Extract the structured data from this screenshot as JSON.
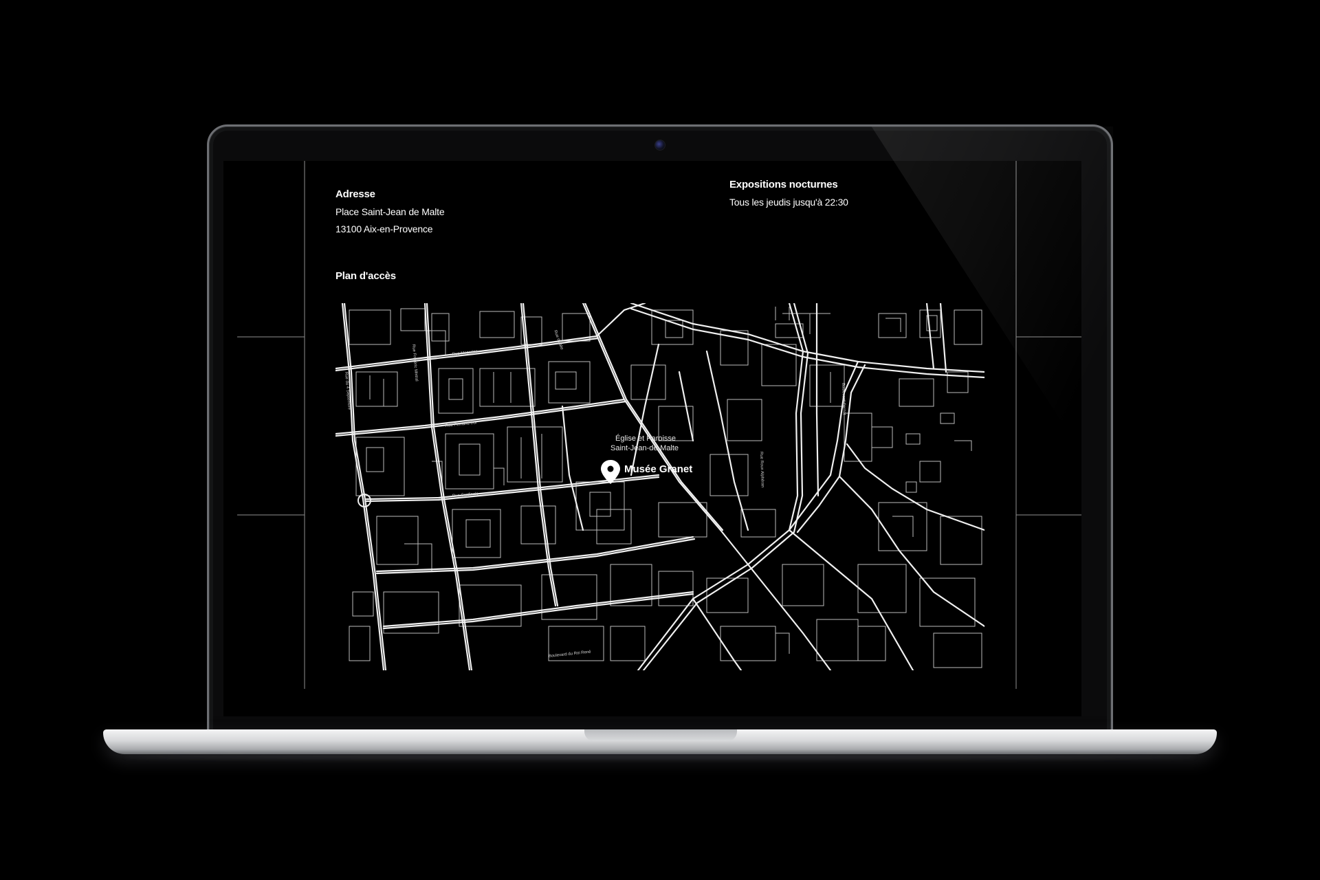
{
  "address": {
    "heading": "Adresse",
    "line1": "Place Saint-Jean de Malte",
    "line2": "13100 Aix-en-Provence"
  },
  "night_exhibitions": {
    "heading": "Expositions nocturnes",
    "text": "Tous les jeudis jusqu'à 22:30"
  },
  "access_map": {
    "heading": "Plan d'accès",
    "museum_label": "Musée Granet",
    "church_label_line1": "Église et Paroisse",
    "church_label_line2": "Saint-Jean-de-Malte",
    "marker_icon": "map-pin-icon",
    "street_labels": {
      "mazarine": "Rue Mazarine",
      "boulevard_roi_rene": "Boulevard du Roi René",
      "boulevard_carnot": "Boulevard Carnot",
      "cardinale": "Rue Cardinale",
      "fernand_dol": "Rue Fernand Dol",
      "frederic_mistral": "Rue Frédéric Mistral",
      "italie": "Rue d'Italie",
      "roux_alpheran": "Rue Roux Alphéran",
      "quatre_septembre": "Rue du 4 Septembre"
    }
  },
  "colors": {
    "background": "#000000",
    "text": "#ffffff",
    "map_lines": "#e6e6e6",
    "frame_lines": "#9a9a9a"
  }
}
